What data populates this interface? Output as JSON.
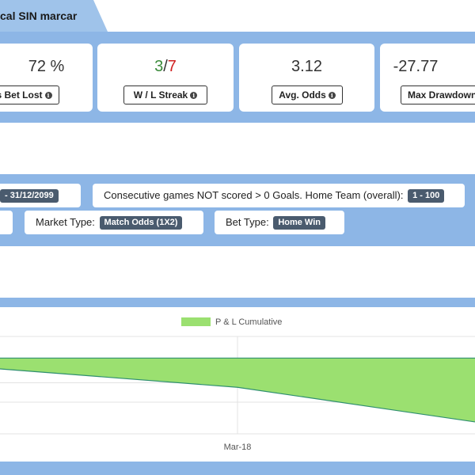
{
  "tab": {
    "title": "cal SIN marcar"
  },
  "stats": [
    {
      "value": "72 %",
      "label": "s Bet Lost"
    },
    {
      "win": "3",
      "sep": "/",
      "loss": "7",
      "label": "W / L Streak"
    },
    {
      "value": "3.12",
      "label": "Avg. Odds"
    },
    {
      "value": "-27.77",
      "label": "Max Drawdown"
    }
  ],
  "filters": {
    "date_range": "- 31/12/2099",
    "consecutive_label": "Consecutive games NOT scored > 0 Goals. Home Team (overall):",
    "consecutive_value": "1 - 100",
    "market_label": "Market Type:",
    "market_value": "Match Odds (1X2)",
    "bet_label": "Bet Type:",
    "bet_value": "Home Win"
  },
  "chart_data": {
    "type": "area",
    "legend": [
      "P & L Cumulative"
    ],
    "legend_placement": "top",
    "series": [
      {
        "name": "P & L Cumulative",
        "color": "#9be070",
        "line_color": "#2f8f6f",
        "points": [
          {
            "t": 0.0,
            "y": -2.0
          },
          {
            "t": 0.5,
            "y": -5.4
          },
          {
            "t": 1.0,
            "y": -11.8
          }
        ]
      }
    ],
    "baseline": 0,
    "ylim": [
      -14,
      4
    ],
    "x_ticks": [
      {
        "t": 0.5,
        "label": "Mar-18"
      }
    ],
    "grid": true
  }
}
